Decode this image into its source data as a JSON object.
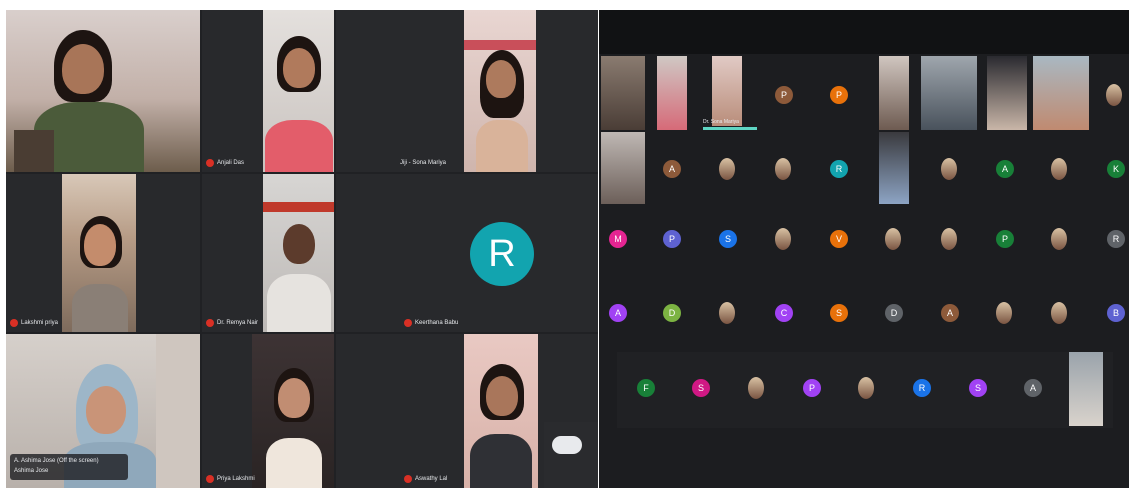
{
  "left_meeting": {
    "names": [
      "Anjali Das",
      "Jiji - Sona Mariya",
      "Lakshmi priya",
      "Dr. Remya Nair",
      "Keerthana Babu",
      "Priya Lakshmi",
      "Aswathy Lal"
    ],
    "big_avatar_initial": "R",
    "presenting_line1": "A. Ashima Jose (Off the screen)",
    "presenting_line2": "Ashima Jose"
  },
  "right_meeting": {
    "speaking_name": "Dr. Sona Mariya",
    "rows": [
      [
        "",
        "",
        "",
        "P",
        "P",
        "",
        "",
        "",
        "",
        ""
      ],
      [
        "",
        "A",
        "",
        "",
        "R",
        "",
        "",
        "A",
        "",
        "K"
      ],
      [
        "M",
        "P",
        "S",
        "",
        "V",
        "",
        "",
        "P",
        "",
        "R"
      ],
      [
        "A",
        "D",
        "",
        "C",
        "S",
        "D",
        "A",
        "",
        "",
        "B"
      ],
      [
        "F",
        "S",
        "",
        "P",
        "",
        "R",
        "S",
        "A",
        ""
      ]
    ],
    "colors": {
      "orange": "#e8710a",
      "brown": "#8d5a3a",
      "teal": "#12a4af",
      "green": "#188038",
      "pink": "#e52592",
      "purple": "#a142f4",
      "indigo": "#5e62d1",
      "blue": "#1a73e8",
      "grey": "#5f6368",
      "rose": "#d01884",
      "olive": "#7cb342"
    }
  }
}
